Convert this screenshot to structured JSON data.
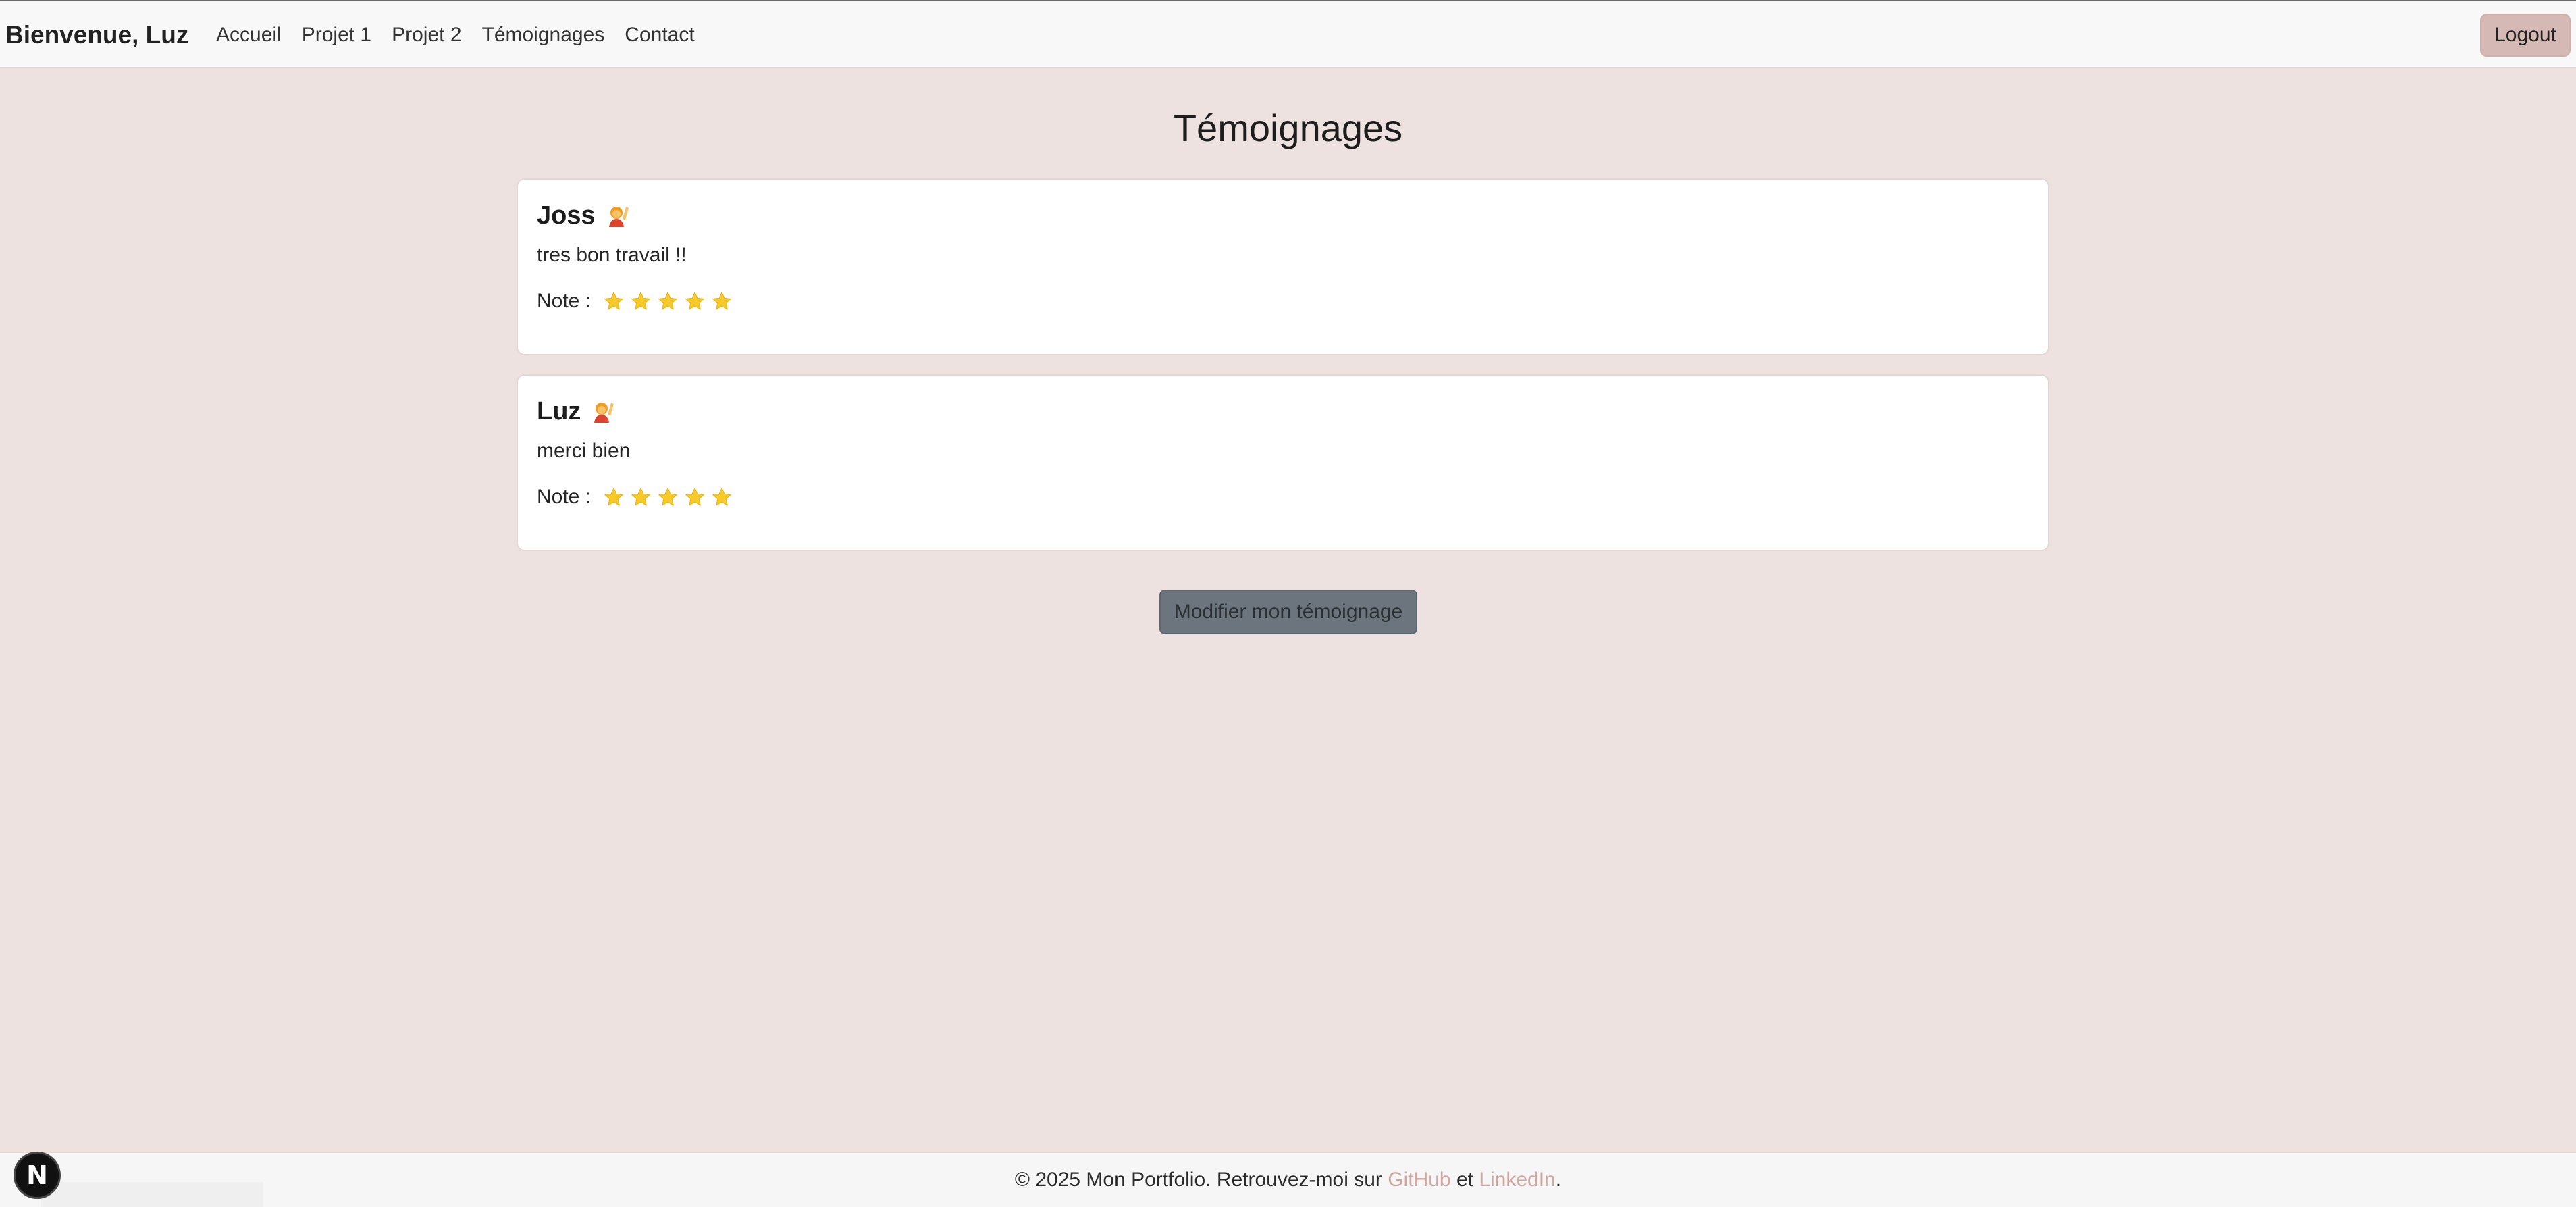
{
  "navbar": {
    "brand": "Bienvenue, Luz",
    "links": [
      {
        "label": "Accueil"
      },
      {
        "label": "Projet 1"
      },
      {
        "label": "Projet 2"
      },
      {
        "label": "Témoignages"
      },
      {
        "label": "Contact"
      }
    ],
    "logout_label": "Logout"
  },
  "main": {
    "title": "Témoignages",
    "testimonials": [
      {
        "author": "Joss",
        "emoji_icon": "person-raising-hand-icon",
        "message": "tres bon travail !!",
        "note_label": "Note :",
        "rating": 5
      },
      {
        "author": "Luz",
        "emoji_icon": "person-raising-hand-icon",
        "message": "merci bien",
        "note_label": "Note :",
        "rating": 5
      }
    ],
    "edit_button_label": "Modifier mon témoignage"
  },
  "footer": {
    "prefix": "© 2025 Mon Portfolio. Retrouvez-moi sur ",
    "github_label": "GitHub",
    "middle": " et ",
    "linkedin_label": "LinkedIn",
    "suffix": "."
  },
  "dev_badge": {
    "glyph": "N",
    "icon": "nextjs-icon"
  },
  "colors": {
    "background": "#ede2e0",
    "accent": "#d5b9b4",
    "link": "#d0a6a1",
    "star": "#f7c928",
    "button": "#6c757d"
  }
}
